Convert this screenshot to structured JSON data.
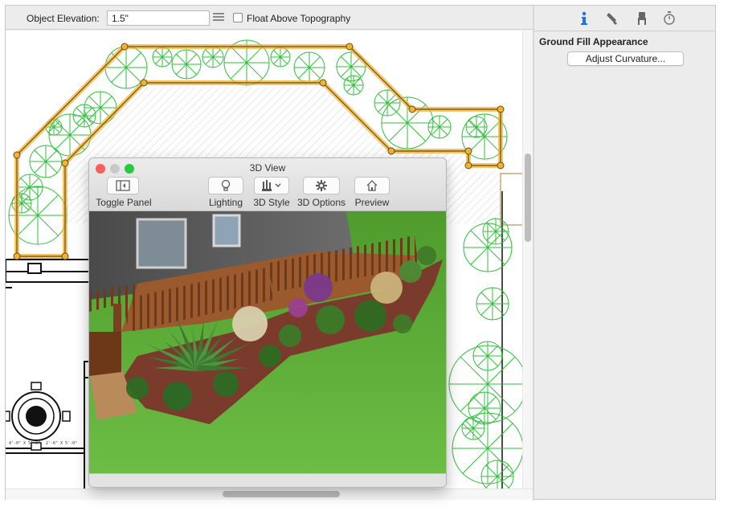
{
  "toolbar": {
    "elevation_label": "Object Elevation:",
    "elevation_value": "1.5\"",
    "float_label": "Float Above Topography",
    "float_checked": false
  },
  "inspector": {
    "tabs": [
      {
        "icon": "info-icon",
        "active": true
      },
      {
        "icon": "brush-icon",
        "active": false
      },
      {
        "icon": "chair-icon",
        "active": false
      },
      {
        "icon": "stopwatch-icon",
        "active": false
      }
    ],
    "section_title": "Ground Fill Appearance",
    "adjust_button": "Adjust Curvature..."
  },
  "view3d": {
    "title": "3D View",
    "buttons": [
      {
        "label": "Toggle Panel",
        "icon": "toggle-panel-icon"
      },
      {
        "label": "Lighting",
        "icon": "lightbulb-icon"
      },
      {
        "label": "3D Style",
        "icon": "paintbrushes-icon",
        "has_dropdown": true
      },
      {
        "label": "3D Options",
        "icon": "gear-icon"
      },
      {
        "label": "Preview",
        "icon": "house-icon"
      }
    ]
  },
  "colors": {
    "selection": "#f2b233",
    "plant": "#2fbf3a",
    "wall": "#111111",
    "close": "#fc5d57",
    "minimize": "#fdbc2e",
    "zoom": "#28c840",
    "grass": "#5fae3a",
    "mulch": "#7a3b2c",
    "deck": "#8b4d25",
    "house": "#5c5c5c"
  }
}
